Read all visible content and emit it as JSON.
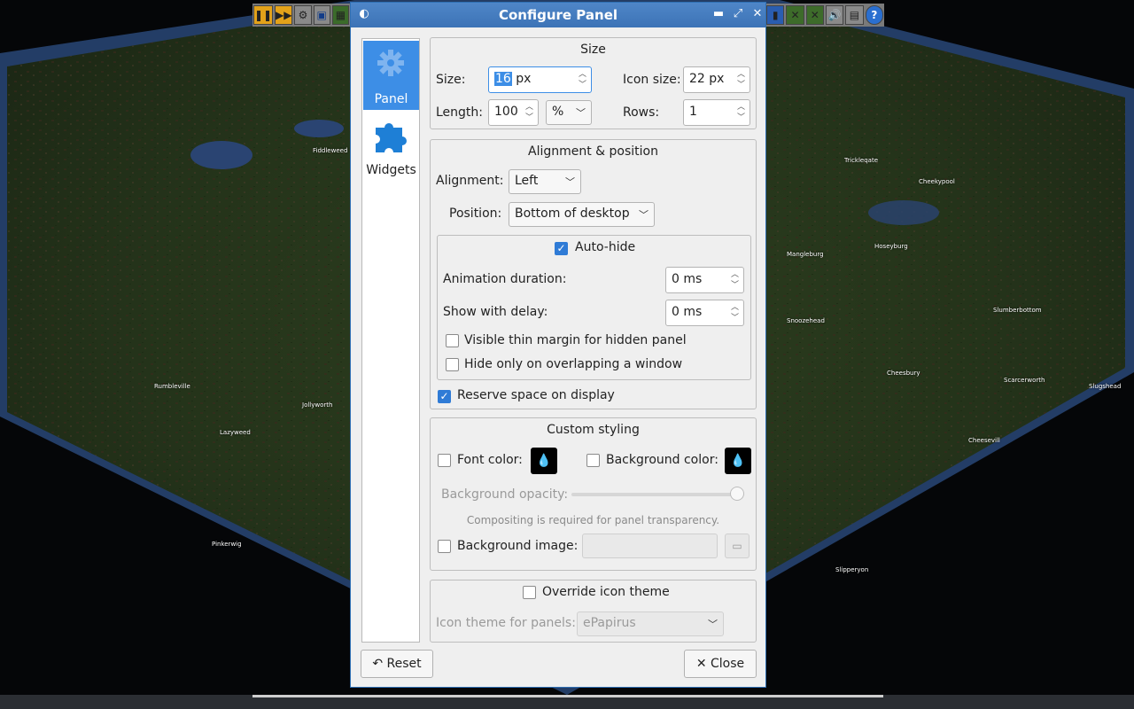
{
  "dialog": {
    "title": "Configure Panel",
    "sidebar": [
      {
        "label": "Panel",
        "icon": "gear-icon"
      },
      {
        "label": "Widgets",
        "icon": "puzzle-icon"
      }
    ],
    "size_group": {
      "title": "Size",
      "size_label": "Size:",
      "size_value_selected": "16",
      "size_value_unit": " px",
      "icon_size_label": "Icon size:",
      "icon_size_value": "22 px",
      "length_label": "Length:",
      "length_value": "100",
      "length_unit": "%",
      "rows_label": "Rows:",
      "rows_value": "1"
    },
    "alignment_group": {
      "title": "Alignment & position",
      "alignment_label": "Alignment:",
      "alignment_value": "Left",
      "position_label": "Position:",
      "position_value": "Bottom of desktop",
      "autohide_label": "Auto-hide",
      "autohide_checked": true,
      "animation_label": "Animation duration:",
      "animation_value": "0 ms",
      "delay_label": "Show with delay:",
      "delay_value": "0 ms",
      "thin_margin_label": "Visible thin margin for hidden panel",
      "overlap_label": "Hide only on overlapping a window",
      "reserve_label": "Reserve space on display",
      "reserve_checked": true
    },
    "styling_group": {
      "title": "Custom styling",
      "font_color_label": "Font color:",
      "bg_color_label": "Background color:",
      "bg_opacity_label": "Background opacity:",
      "bg_opacity_value": 1.0,
      "compositing_note": "Compositing is required for panel transparency.",
      "bg_image_label": "Background image:"
    },
    "icon_theme_group": {
      "override_label": "Override icon theme",
      "theme_label": "Icon theme for panels:",
      "theme_value": "ePapirus"
    },
    "reset_label": "Reset",
    "close_label": "Close"
  },
  "map": {
    "towns": [
      "Fiddleweed",
      "Trickleqate",
      "Cheekypool",
      "Mangleburg",
      "Hoseyburg",
      "Snoozehead",
      "Slumberbottom",
      "Rumbleville",
      "Jollyworth",
      "Lazyweed",
      "Cheesbury",
      "Scarcerworth",
      "Slugshead",
      "Cheesevill",
      "Pinkerwig",
      "Slipperyon"
    ]
  },
  "colors": {
    "accent": "#3d8ee6",
    "titlebar": "#4a80c2"
  }
}
